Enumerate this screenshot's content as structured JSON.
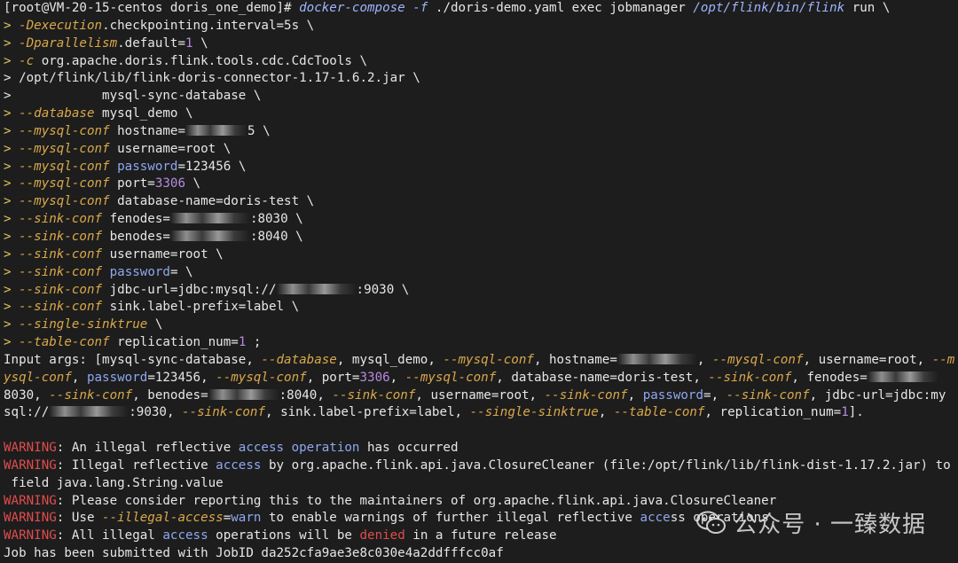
{
  "terminal": {
    "lines": [
      [
        {
          "t": "[root@VM-20-15-centos doris_one_demo]# ",
          "c": "p"
        },
        {
          "t": "docker-compose",
          "c": "cmd"
        },
        {
          "t": " ",
          "c": "p"
        },
        {
          "t": "-f",
          "c": "cmd"
        },
        {
          "t": " ./doris-demo.yaml exec jobmanager ",
          "c": "p"
        },
        {
          "t": "/opt/flink/bin/flink",
          "c": "cmd"
        },
        {
          "t": " run \\",
          "c": "p"
        }
      ],
      [
        {
          "t": "> ",
          "c": "prompt-gt"
        },
        {
          "t": "-Dexecution",
          "c": "flag"
        },
        {
          "t": ".checkpointing.interval=5s \\",
          "c": "p"
        }
      ],
      [
        {
          "t": "> ",
          "c": "prompt-gt"
        },
        {
          "t": "-Dparallelism",
          "c": "flag"
        },
        {
          "t": ".default=",
          "c": "p"
        },
        {
          "t": "1",
          "c": "num"
        },
        {
          "t": " \\",
          "c": "p"
        }
      ],
      [
        {
          "t": "> ",
          "c": "prompt-gt"
        },
        {
          "t": "-c",
          "c": "flag"
        },
        {
          "t": " org.apache.doris.flink.tools.cdc.CdcTools \\",
          "c": "p"
        }
      ],
      [
        {
          "t": "> /opt/flink/lib/flink-doris-connector-1.17-1.6.2.jar \\",
          "c": "p"
        }
      ],
      [
        {
          "t": ">            mysql-sync-database \\",
          "c": "p"
        }
      ],
      [
        {
          "t": "> ",
          "c": "prompt-gt"
        },
        {
          "t": "--database",
          "c": "flag"
        },
        {
          "t": " mysql_demo \\",
          "c": "p"
        }
      ],
      [
        {
          "t": "> ",
          "c": "prompt-gt"
        },
        {
          "t": "--mysql-conf",
          "c": "flag"
        },
        {
          "t": " hostname=",
          "c": "p"
        },
        {
          "t": "",
          "c": "blur",
          "w": 70
        },
        {
          "t": "5 \\",
          "c": "p"
        }
      ],
      [
        {
          "t": "> ",
          "c": "prompt-gt"
        },
        {
          "t": "--mysql-conf",
          "c": "flag"
        },
        {
          "t": " username=root \\",
          "c": "p"
        }
      ],
      [
        {
          "t": "> ",
          "c": "prompt-gt"
        },
        {
          "t": "--mysql-conf",
          "c": "flag"
        },
        {
          "t": " ",
          "c": "p"
        },
        {
          "t": "password",
          "c": "kw"
        },
        {
          "t": "=123456 \\",
          "c": "p"
        }
      ],
      [
        {
          "t": "> ",
          "c": "prompt-gt"
        },
        {
          "t": "--mysql-conf",
          "c": "flag"
        },
        {
          "t": " port=",
          "c": "p"
        },
        {
          "t": "3306",
          "c": "num"
        },
        {
          "t": " \\",
          "c": "p"
        }
      ],
      [
        {
          "t": "> ",
          "c": "prompt-gt"
        },
        {
          "t": "--mysql-conf",
          "c": "flag"
        },
        {
          "t": " database-name=doris-test \\",
          "c": "p"
        }
      ],
      [
        {
          "t": "> ",
          "c": "prompt-gt"
        },
        {
          "t": "--sink-conf",
          "c": "flag"
        },
        {
          "t": " fenodes=",
          "c": "p"
        },
        {
          "t": "",
          "c": "blur",
          "w": 90
        },
        {
          "t": ":8030 \\",
          "c": "p"
        }
      ],
      [
        {
          "t": "> ",
          "c": "prompt-gt"
        },
        {
          "t": "--sink-conf",
          "c": "flag"
        },
        {
          "t": " benodes=",
          "c": "p"
        },
        {
          "t": "",
          "c": "blur",
          "w": 90
        },
        {
          "t": ":8040 \\",
          "c": "p"
        }
      ],
      [
        {
          "t": "> ",
          "c": "prompt-gt"
        },
        {
          "t": "--sink-conf",
          "c": "flag"
        },
        {
          "t": " username=root \\",
          "c": "p"
        }
      ],
      [
        {
          "t": "> ",
          "c": "prompt-gt"
        },
        {
          "t": "--sink-conf",
          "c": "flag"
        },
        {
          "t": " ",
          "c": "p"
        },
        {
          "t": "password",
          "c": "kw"
        },
        {
          "t": "= \\",
          "c": "p"
        }
      ],
      [
        {
          "t": "> ",
          "c": "prompt-gt"
        },
        {
          "t": "--sink-conf",
          "c": "flag"
        },
        {
          "t": " jdbc-url=jdbc:mysql://",
          "c": "p"
        },
        {
          "t": "",
          "c": "blur",
          "w": 90
        },
        {
          "t": ":9030 \\",
          "c": "p"
        }
      ],
      [
        {
          "t": "> ",
          "c": "prompt-gt"
        },
        {
          "t": "--sink-conf",
          "c": "flag"
        },
        {
          "t": " sink.label-prefix=label \\",
          "c": "p"
        }
      ],
      [
        {
          "t": "> ",
          "c": "prompt-gt"
        },
        {
          "t": "--single-sinktrue",
          "c": "flag"
        },
        {
          "t": " \\",
          "c": "p"
        }
      ],
      [
        {
          "t": "> ",
          "c": "prompt-gt"
        },
        {
          "t": "--table-conf",
          "c": "flag"
        },
        {
          "t": " replication_num=",
          "c": "p"
        },
        {
          "t": "1",
          "c": "num"
        },
        {
          "t": " ;",
          "c": "p"
        }
      ],
      [
        {
          "t": "Input args: [mysql-sync-database, ",
          "c": "p"
        },
        {
          "t": "--database",
          "c": "flag"
        },
        {
          "t": ", mysql_demo, ",
          "c": "p"
        },
        {
          "t": "--mysql-conf",
          "c": "flag"
        },
        {
          "t": ", hostname=",
          "c": "p"
        },
        {
          "t": "",
          "c": "blur",
          "w": 90
        },
        {
          "t": ", ",
          "c": "p"
        },
        {
          "t": "--mysql-conf",
          "c": "flag"
        },
        {
          "t": ", username=root, ",
          "c": "p"
        },
        {
          "t": "--m",
          "c": "flag"
        }
      ],
      [
        {
          "t": "ysql-conf",
          "c": "flag"
        },
        {
          "t": ", ",
          "c": "p"
        },
        {
          "t": "password",
          "c": "kw"
        },
        {
          "t": "=123456, ",
          "c": "p"
        },
        {
          "t": "--mysql-conf",
          "c": "flag"
        },
        {
          "t": ", port=",
          "c": "p"
        },
        {
          "t": "3306",
          "c": "num"
        },
        {
          "t": ", ",
          "c": "p"
        },
        {
          "t": "--mysql-conf",
          "c": "flag"
        },
        {
          "t": ", database-name=doris-test, ",
          "c": "p"
        },
        {
          "t": "--sink-conf",
          "c": "flag"
        },
        {
          "t": ", fenodes=",
          "c": "p"
        },
        {
          "t": "",
          "c": "blur",
          "w": 80
        }
      ],
      [
        {
          "t": "8030, ",
          "c": "p"
        },
        {
          "t": "--sink-conf",
          "c": "flag"
        },
        {
          "t": ", benodes=",
          "c": "p"
        },
        {
          "t": "",
          "c": "blur",
          "w": 80
        },
        {
          "t": ":8040, ",
          "c": "p"
        },
        {
          "t": "--sink-conf",
          "c": "flag"
        },
        {
          "t": ", username=root, ",
          "c": "p"
        },
        {
          "t": "--sink-conf",
          "c": "flag"
        },
        {
          "t": ", ",
          "c": "p"
        },
        {
          "t": "password",
          "c": "kw"
        },
        {
          "t": "=, ",
          "c": "p"
        },
        {
          "t": "--sink-conf",
          "c": "flag"
        },
        {
          "t": ", jdbc-url=jdbc:my",
          "c": "p"
        }
      ],
      [
        {
          "t": "sql://",
          "c": "p"
        },
        {
          "t": "",
          "c": "blur",
          "w": 90
        },
        {
          "t": ":9030, ",
          "c": "p"
        },
        {
          "t": "--sink-conf",
          "c": "flag"
        },
        {
          "t": ", sink.label-prefix=label, ",
          "c": "p"
        },
        {
          "t": "--single-sinktrue",
          "c": "flag"
        },
        {
          "t": ", ",
          "c": "p"
        },
        {
          "t": "--table-conf",
          "c": "flag"
        },
        {
          "t": ", replication_num=",
          "c": "p"
        },
        {
          "t": "1",
          "c": "num"
        },
        {
          "t": "].",
          "c": "p"
        }
      ],
      [
        {
          "t": "",
          "c": "p"
        }
      ],
      [
        {
          "t": "WARNING",
          "c": "warn"
        },
        {
          "t": ": An illegal reflective ",
          "c": "p"
        },
        {
          "t": "access operation",
          "c": "kw"
        },
        {
          "t": " has occurred",
          "c": "p"
        }
      ],
      [
        {
          "t": "WARNING",
          "c": "warn"
        },
        {
          "t": ": Illegal reflective ",
          "c": "p"
        },
        {
          "t": "access",
          "c": "kw"
        },
        {
          "t": " by org.apache.flink.api.java.ClosureCleaner (file:/opt/flink/lib/flink-dist-1.17.2.jar) to",
          "c": "p"
        }
      ],
      [
        {
          "t": " field java.lang.String.value",
          "c": "p"
        }
      ],
      [
        {
          "t": "WARNING",
          "c": "warn"
        },
        {
          "t": ": Please consider reporting this to the maintainers of org.apache.flink.api.java.ClosureCleaner",
          "c": "p"
        }
      ],
      [
        {
          "t": "WARNING",
          "c": "warn"
        },
        {
          "t": ": Use ",
          "c": "p"
        },
        {
          "t": "--illegal-access",
          "c": "flag"
        },
        {
          "t": "=",
          "c": "p"
        },
        {
          "t": "warn",
          "c": "kw"
        },
        {
          "t": " to enable warnings of further illegal reflective ",
          "c": "p"
        },
        {
          "t": "acce",
          "c": "kw"
        },
        {
          "t": "ss operations",
          "c": "p"
        }
      ],
      [
        {
          "t": "WARNING",
          "c": "warn"
        },
        {
          "t": ": All illegal ",
          "c": "p"
        },
        {
          "t": "access",
          "c": "kw"
        },
        {
          "t": " operations will be ",
          "c": "p"
        },
        {
          "t": "denied",
          "c": "warn"
        },
        {
          "t": " in a future release",
          "c": "p"
        }
      ],
      [
        {
          "t": "Job has been submitted with JobID da252cfa9ae3e8c030e4a2ddfffcc0af",
          "c": "p"
        }
      ]
    ]
  },
  "watermark": {
    "icon": "wechat-icon",
    "text": "公众号 · 一臻数据"
  }
}
